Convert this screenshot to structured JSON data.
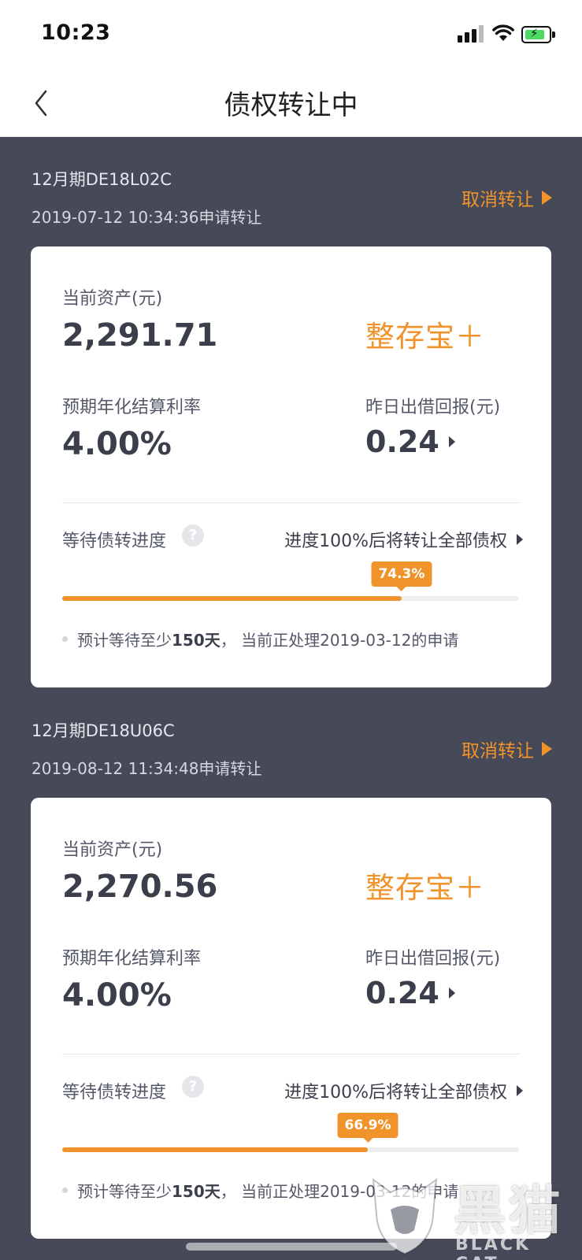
{
  "status_bar": {
    "time": "10:23"
  },
  "nav": {
    "title": "债权转让中"
  },
  "items": [
    {
      "period": "12月期DE18L02C",
      "apply_time": "2019-07-12 10:34:36申请转让",
      "cancel_label": "取消转让",
      "asset_label": "当前资产(元)",
      "asset_value": "2,291.71",
      "product_name": "整存宝＋",
      "rate_label": "预期年化结算利率",
      "rate_value": "4.00%",
      "return_label": "昨日出借回报(元)",
      "return_value": "0.24",
      "progress_label": "等待债转进度",
      "help_symbol": "?",
      "progress_note": "进度100%后将转让全部债权",
      "progress_percent": 74.3,
      "progress_text": "74.3%",
      "wait_prefix": "预计等待至少",
      "wait_days": "150天",
      "wait_suffix": "，  当前正处理2019-03-12的申请"
    },
    {
      "period": "12月期DE18U06C",
      "apply_time": "2019-08-12 11:34:48申请转让",
      "cancel_label": "取消转让",
      "asset_label": "当前资产(元)",
      "asset_value": "2,270.56",
      "product_name": "整存宝＋",
      "rate_label": "预期年化结算利率",
      "rate_value": "4.00%",
      "return_label": "昨日出借回报(元)",
      "return_value": "0.24",
      "progress_label": "等待债转进度",
      "help_symbol": "?",
      "progress_note": "进度100%后将转让全部债权",
      "progress_percent": 66.9,
      "progress_text": "66.9%",
      "wait_prefix": "预计等待至少",
      "wait_days": "150天",
      "wait_suffix": "，  当前正处理2019-03-12的申请"
    }
  ],
  "watermark": {
    "text": "黑猫",
    "sub": "BLACK CAT"
  },
  "colors": {
    "accent": "#f0932b",
    "background": "#464958"
  }
}
